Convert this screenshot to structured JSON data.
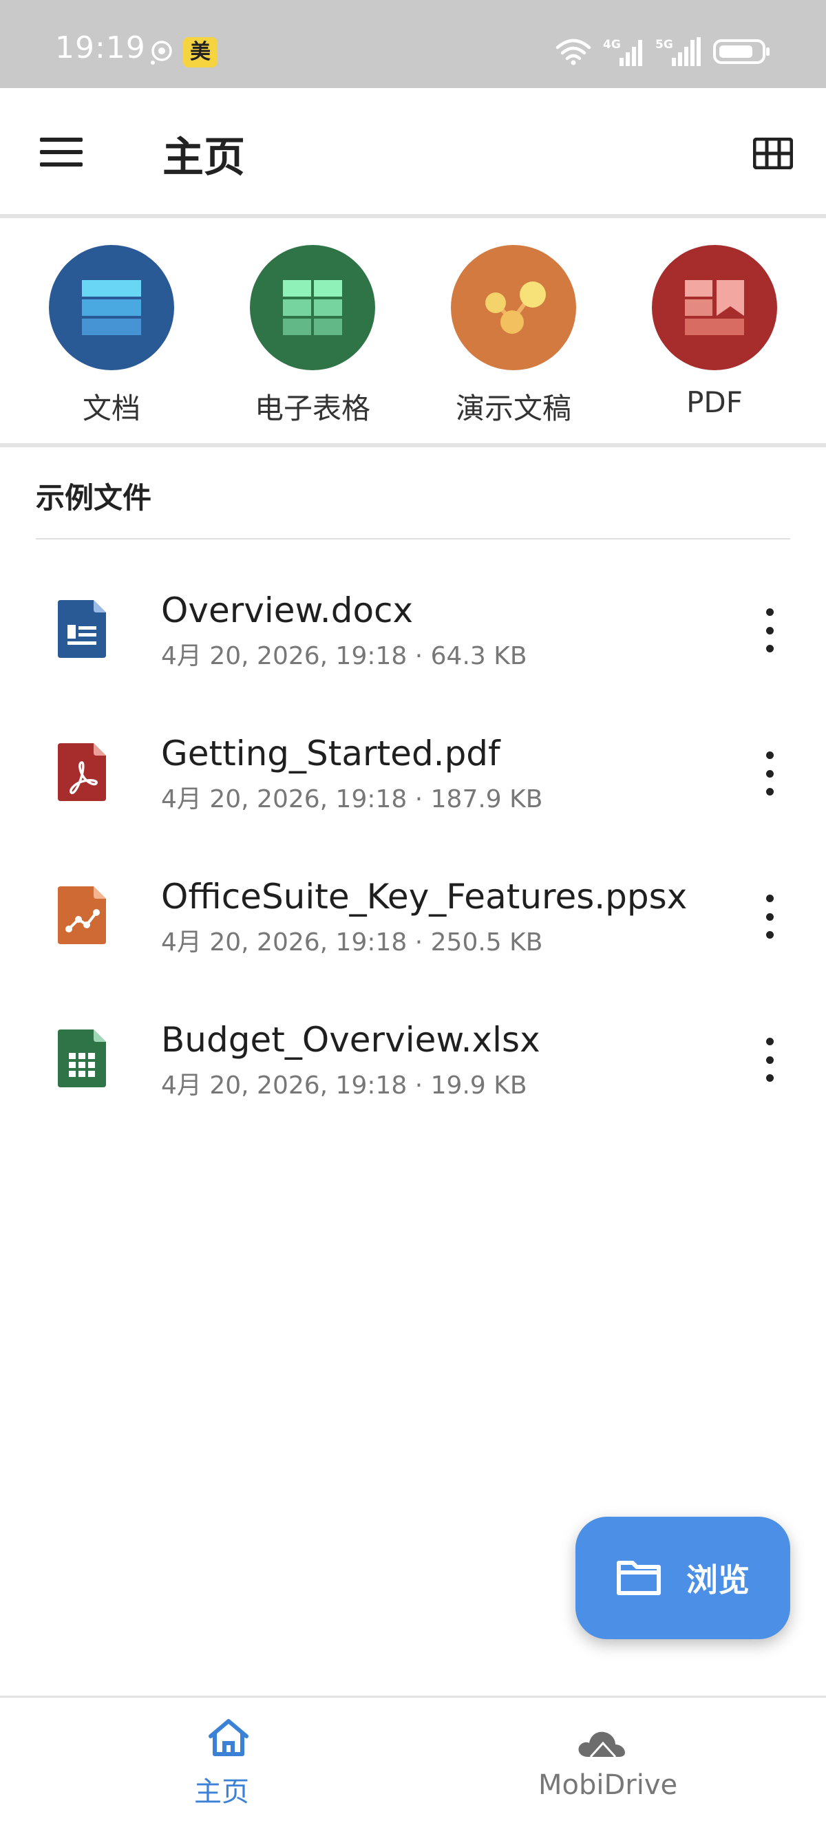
{
  "status_bar": {
    "time": "19:19",
    "badge": "美",
    "network_labels": [
      "4G",
      "5G"
    ]
  },
  "app_bar": {
    "title": "主页"
  },
  "quick_types": [
    {
      "label": "文档",
      "color": "#2a5a95",
      "icon": "document-icon"
    },
    {
      "label": "电子表格",
      "color": "#2e7447",
      "icon": "spreadsheet-icon"
    },
    {
      "label": "演示文稿",
      "color": "#d27a3f",
      "icon": "presentation-icon"
    },
    {
      "label": "PDF",
      "color": "#a72c2c",
      "icon": "pdf-icon"
    }
  ],
  "section": {
    "title": "示例文件"
  },
  "files": [
    {
      "name": "Overview.docx",
      "date": "4月 20, 2026, 19:18",
      "size": "64.3 KB",
      "icon": "docx-file-icon",
      "color": "#2a5a95"
    },
    {
      "name": "Getting_Started.pdf",
      "date": "4月 20, 2026, 19:18",
      "size": "187.9 KB",
      "icon": "pdf-file-icon",
      "color": "#a72c2c"
    },
    {
      "name": "OfficeSuite_Key_Features.ppsx",
      "date": "4月 20, 2026, 19:18",
      "size": "250.5 KB",
      "icon": "ppsx-file-icon",
      "color": "#d06a35"
    },
    {
      "name": "Budget_Overview.xlsx",
      "date": "4月 20, 2026, 19:18",
      "size": "19.9 KB",
      "icon": "xlsx-file-icon",
      "color": "#2e7447"
    }
  ],
  "fab": {
    "label": "浏览",
    "color": "#4b8fe6"
  },
  "bottom_nav": [
    {
      "label": "主页",
      "active": true,
      "color": "#3b82d6"
    },
    {
      "label": "MobiDrive",
      "active": false,
      "color": "#777777"
    }
  ]
}
